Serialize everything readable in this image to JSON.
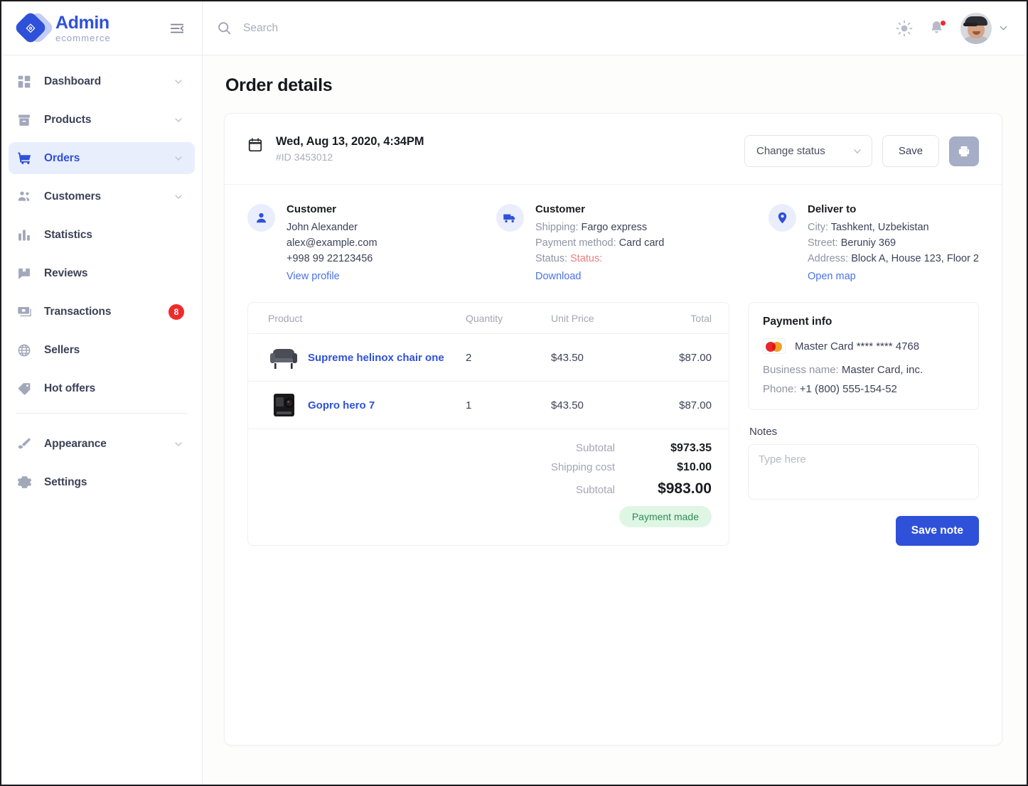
{
  "brand": {
    "title": "Admin",
    "subtitle": "ecommerce",
    "logo_icon": "diamond-tag-logo",
    "collapse_icon": "menu-collapse-icon"
  },
  "sidebar": {
    "items": [
      {
        "label": "Dashboard",
        "icon": "grid-icon",
        "chevron": true,
        "active": false
      },
      {
        "label": "Products",
        "icon": "box-icon",
        "chevron": true,
        "active": false
      },
      {
        "label": "Orders",
        "icon": "cart-icon",
        "chevron": true,
        "active": true
      },
      {
        "label": "Customers",
        "icon": "people-icon",
        "chevron": true,
        "active": false
      },
      {
        "label": "Statistics",
        "icon": "bar-chart-icon",
        "chevron": false,
        "active": false
      },
      {
        "label": "Reviews",
        "icon": "bookmark-chat-icon",
        "chevron": false,
        "active": false
      },
      {
        "label": "Transactions",
        "icon": "money-icon",
        "chevron": false,
        "active": false,
        "badge": "8"
      },
      {
        "label": "Sellers",
        "icon": "globe-icon",
        "chevron": false,
        "active": false
      },
      {
        "label": "Hot offers",
        "icon": "tag-icon",
        "chevron": false,
        "active": false
      }
    ],
    "items_bottom": [
      {
        "label": "Appearance",
        "icon": "brush-icon",
        "chevron": true,
        "active": false
      },
      {
        "label": "Settings",
        "icon": "gear-icon",
        "chevron": false,
        "active": false
      }
    ]
  },
  "topbar": {
    "search_placeholder": "Search",
    "search_value": "",
    "search_icon": "search-icon",
    "theme_icon": "sun-icon",
    "bell_icon": "bell-icon",
    "avatar_icon": "user-avatar",
    "chevron_icon": "chevron-down-icon"
  },
  "page": {
    "title": "Order details"
  },
  "order": {
    "calendar_icon": "calendar-icon",
    "date": "Wed, Aug 13, 2020, 4:34PM",
    "id": "#ID 3453012",
    "status_select": {
      "label": "Change status",
      "chevron": "chevron-down-icon"
    },
    "save_label": "Save",
    "print_icon": "printer-icon"
  },
  "customer": {
    "icon": "person-icon",
    "title": "Customer",
    "name": "John Alexander",
    "email": "alex@example.com",
    "phone": "+998 99 22123456",
    "link": "View profile"
  },
  "shipping": {
    "icon": "truck-icon",
    "title": "Customer",
    "shipping_key": "Shipping:",
    "shipping_value": "Fargo express",
    "payment_key": "Payment method:",
    "payment_value": "Card card",
    "status_key": "Status:",
    "status_value": "Status:",
    "status_color": "#ef7d7d",
    "link": "Download"
  },
  "deliver": {
    "icon": "location-pin-icon",
    "title": "Deliver to",
    "city_key": "City:",
    "city_value": "Tashkent, Uzbekistan",
    "street_key": "Street:",
    "street_value": "Beruniy 369",
    "address_key": "Address:",
    "address_value": "Block A, House 123, Floor 2",
    "link": "Open map"
  },
  "products_table": {
    "columns": [
      "Product",
      "Quantity",
      "Unit Price",
      "Total"
    ],
    "rows": [
      {
        "thumb": "armchair-thumbnail",
        "name": "Supreme helinox chair one",
        "quantity": "2",
        "unit_price": "$43.50",
        "total": "$87.00"
      },
      {
        "thumb": "gopro-camera-thumbnail",
        "name": "Gopro hero 7",
        "quantity": "1",
        "unit_price": "$43.50",
        "total": "$87.00"
      }
    ]
  },
  "totals": {
    "subtotal_label": "Subtotal",
    "subtotal_value": "$973.35",
    "shipping_label": "Shipping cost",
    "shipping_value": "$10.00",
    "grand_label": "Subtotal",
    "grand_value": "$983.00",
    "badge": "Payment made",
    "badge_color": "#2e8b52"
  },
  "payment_info": {
    "title": "Payment info",
    "card_icon": "mastercard-icon",
    "card_text": "Master Card **** **** 4768",
    "business_key": "Business name:",
    "business_value": "Master Card, inc.",
    "phone_key": "Phone:",
    "phone_value": "+1 (800) 555-154-52"
  },
  "notes": {
    "label": "Notes",
    "placeholder": "Type here",
    "value": "",
    "save_label": "Save note"
  },
  "colors": {
    "accent": "#2f51d9",
    "danger": "#ef2b2b",
    "success": "#2e8b52",
    "muted": "#a2a7b4"
  }
}
